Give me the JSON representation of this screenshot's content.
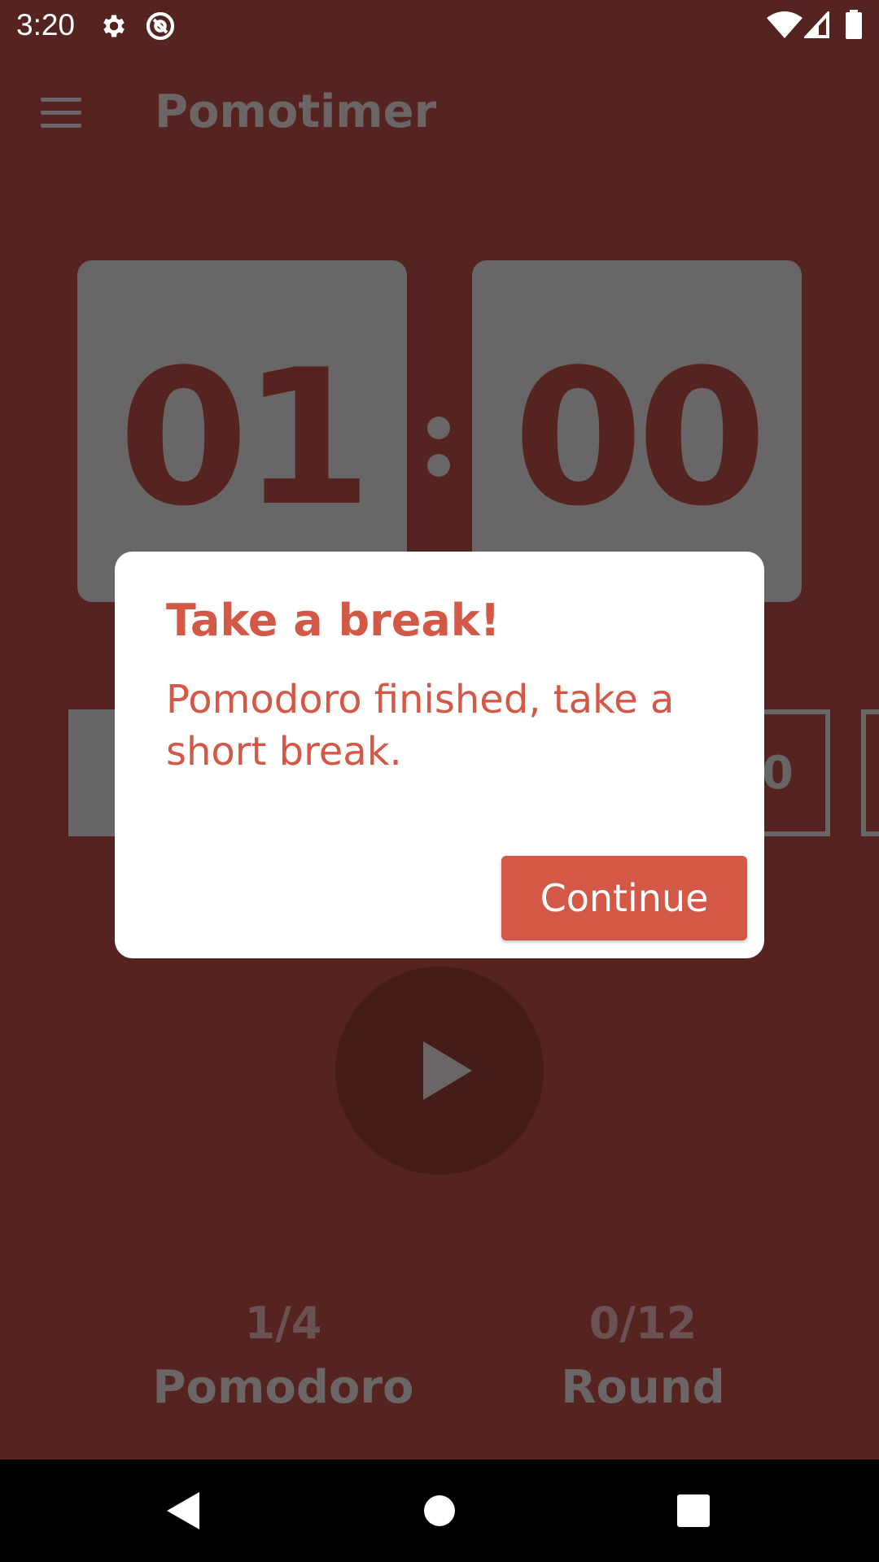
{
  "status_bar": {
    "time": "3:20",
    "icons": [
      "settings-icon",
      "at-sign-icon",
      "wifi-icon",
      "cellular-signal-icon",
      "battery-icon"
    ]
  },
  "app_bar": {
    "menu_icon": "menu-icon",
    "title": "Pomotimer"
  },
  "timer": {
    "minutes": "01",
    "seconds": "00",
    "separator": ":"
  },
  "sessions": {
    "visible_partial_value": "0"
  },
  "controls": {
    "play_icon": "play-icon"
  },
  "stats": {
    "pomodoro_count": "1/4",
    "pomodoro_label": "Pomodoro",
    "round_count": "0/12",
    "round_label": "Round"
  },
  "dialog": {
    "title": "Take a break!",
    "message": "Pomodoro finished, take a short break.",
    "button_label": "Continue"
  },
  "nav_bar": {
    "icons": [
      "back-icon",
      "home-icon",
      "recents-icon"
    ]
  },
  "colors": {
    "background": "#552421",
    "timer_box": "#686667",
    "accent": "#d35846",
    "dialog_background": "#ffffff",
    "play_button": "#461c19"
  }
}
